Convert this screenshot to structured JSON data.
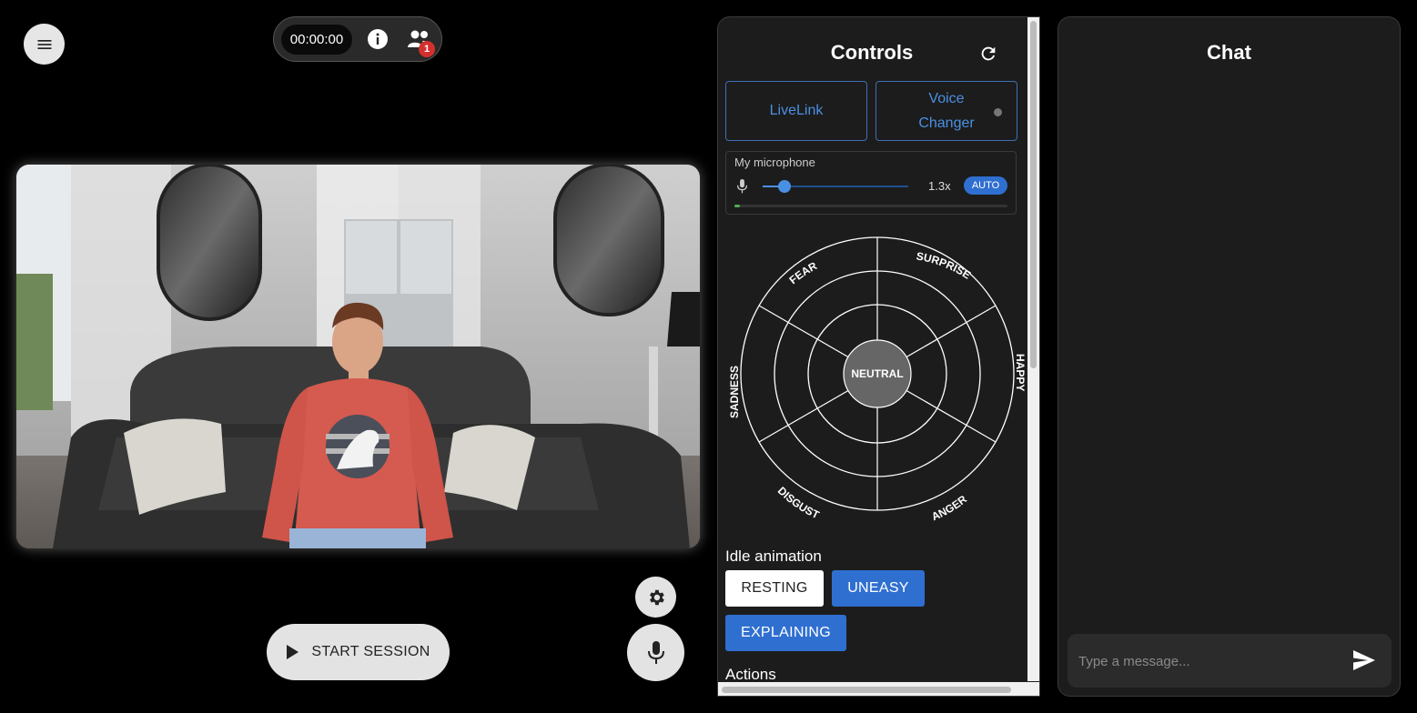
{
  "header": {
    "timer": "00:00:00",
    "participants_count": "1"
  },
  "icons": {
    "menu": "menu-icon",
    "info": "info-icon",
    "people": "people-icon",
    "settings": "gear-icon",
    "play": "play-icon",
    "microphone": "microphone-icon",
    "refresh": "refresh-icon",
    "send": "send-icon"
  },
  "video": {
    "scene": "avatar-video-feed"
  },
  "session": {
    "start_label": "START SESSION"
  },
  "controls": {
    "title": "Controls",
    "livelink_label": "LiveLink",
    "voice_changer_label_line1": "Voice",
    "voice_changer_label_line2": "Changer",
    "microphone": {
      "label": "My microphone",
      "gain": "1.3x",
      "gain_fraction": 0.15,
      "auto_label": "AUTO",
      "input_level_fraction": 0.02
    },
    "emotions": {
      "center": "NEUTRAL",
      "labels": [
        "FEAR",
        "SURPRISE",
        "HAPPY",
        "ANGER",
        "DISGUST",
        "SADNESS"
      ]
    },
    "idle_animation": {
      "title": "Idle animation",
      "options": [
        "RESTING",
        "UNEASY",
        "EXPLAINING"
      ]
    },
    "actions_title": "Actions"
  },
  "chat": {
    "title": "Chat",
    "input_placeholder": "Type a message..."
  },
  "colors": {
    "accent_blue": "#2f6fd0",
    "panel_bg": "#1c1c1c",
    "badge_red": "#d32f2f",
    "level_green": "#4caf50"
  }
}
